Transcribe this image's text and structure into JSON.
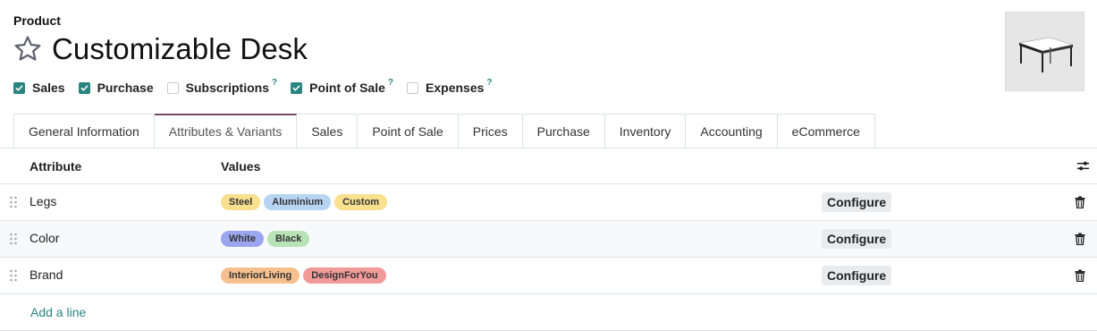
{
  "header": {
    "label": "Product",
    "title": "Customizable Desk"
  },
  "flags": [
    {
      "label": "Sales",
      "checked": true,
      "help": ""
    },
    {
      "label": "Purchase",
      "checked": true,
      "help": ""
    },
    {
      "label": "Subscriptions",
      "checked": false,
      "help": "?"
    },
    {
      "label": "Point of Sale",
      "checked": true,
      "help": "?"
    },
    {
      "label": "Expenses",
      "checked": false,
      "help": "?"
    }
  ],
  "tabs": [
    {
      "label": "General Information",
      "active": false
    },
    {
      "label": "Attributes & Variants",
      "active": true
    },
    {
      "label": "Sales",
      "active": false
    },
    {
      "label": "Point of Sale",
      "active": false
    },
    {
      "label": "Prices",
      "active": false
    },
    {
      "label": "Purchase",
      "active": false
    },
    {
      "label": "Inventory",
      "active": false
    },
    {
      "label": "Accounting",
      "active": false
    },
    {
      "label": "eCommerce",
      "active": false
    }
  ],
  "table": {
    "columns": {
      "attribute": "Attribute",
      "values": "Values"
    },
    "rows": [
      {
        "attribute": "Legs",
        "values": [
          {
            "label": "Steel",
            "color": "#f8e08e"
          },
          {
            "label": "Aluminium",
            "color": "#b7d5f2"
          },
          {
            "label": "Custom",
            "color": "#f8e08e"
          }
        ],
        "configure_label": "Configure"
      },
      {
        "attribute": "Color",
        "values": [
          {
            "label": "White",
            "color": "#9aa6f0"
          },
          {
            "label": "Black",
            "color": "#b7e3b6"
          }
        ],
        "configure_label": "Configure"
      },
      {
        "attribute": "Brand",
        "values": [
          {
            "label": "InteriorLiving",
            "color": "#f5c08e"
          },
          {
            "label": "DesignForYou",
            "color": "#f19a9a"
          }
        ],
        "configure_label": "Configure"
      }
    ],
    "add_line_label": "Add a line"
  },
  "colors": {
    "accent": "#2a8480",
    "tab_active_border": "#714b67"
  }
}
